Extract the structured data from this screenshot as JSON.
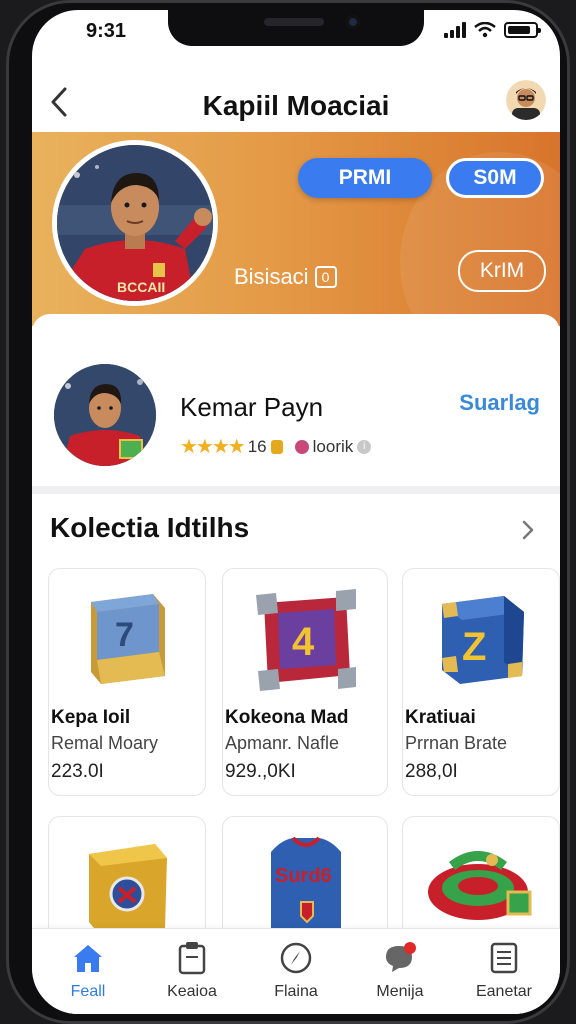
{
  "status_bar": {
    "time": "9:31",
    "battery_level": 0.85
  },
  "nav": {
    "title": "Kapiil Moaciai"
  },
  "hero": {
    "primary_button": "PRMI",
    "secondary_button": "S0M",
    "outline_button": "KrIM",
    "status_text": "Bisisaci",
    "status_badge": "0",
    "jersey_text": "BCCAII"
  },
  "profile": {
    "name": "Kemar Payn",
    "rating_stars": "★★★★",
    "rating_value": "16",
    "tag": "loorik",
    "action": "Suarlag"
  },
  "section": {
    "title": "Kolectia Idtilhs"
  },
  "cards": [
    {
      "name": "Kepa Ioil",
      "sub": "Remal Moary",
      "price": "223.0I",
      "art": "7"
    },
    {
      "name": "Kokeona Mad",
      "sub": "Apmanr. Nafle",
      "price": "929.,0KI",
      "art": "4"
    },
    {
      "name": "Kratiuai",
      "sub": "Prrnan Brate",
      "price": "288,0I",
      "art": "Z"
    },
    {
      "name": "",
      "sub": "",
      "price": "",
      "art": ""
    },
    {
      "name": "",
      "sub": "",
      "price": "",
      "art": "Surd6"
    },
    {
      "name": "",
      "sub": "",
      "price": "",
      "art": ""
    }
  ],
  "tabs": [
    {
      "label": "Feall",
      "icon": "home-icon",
      "active": true
    },
    {
      "label": "Keaioa",
      "icon": "clipboard-icon",
      "active": false
    },
    {
      "label": "Flaina",
      "icon": "compass-icon",
      "active": false
    },
    {
      "label": "Menija",
      "icon": "chat-bubble-icon",
      "active": false
    },
    {
      "label": "Eanetar",
      "icon": "document-icon",
      "active": false
    }
  ],
  "colors": {
    "accent": "#3a7cf0",
    "hero_start": "#e9b25c",
    "hero_end": "#d8742b",
    "link": "#3a8ad8"
  }
}
